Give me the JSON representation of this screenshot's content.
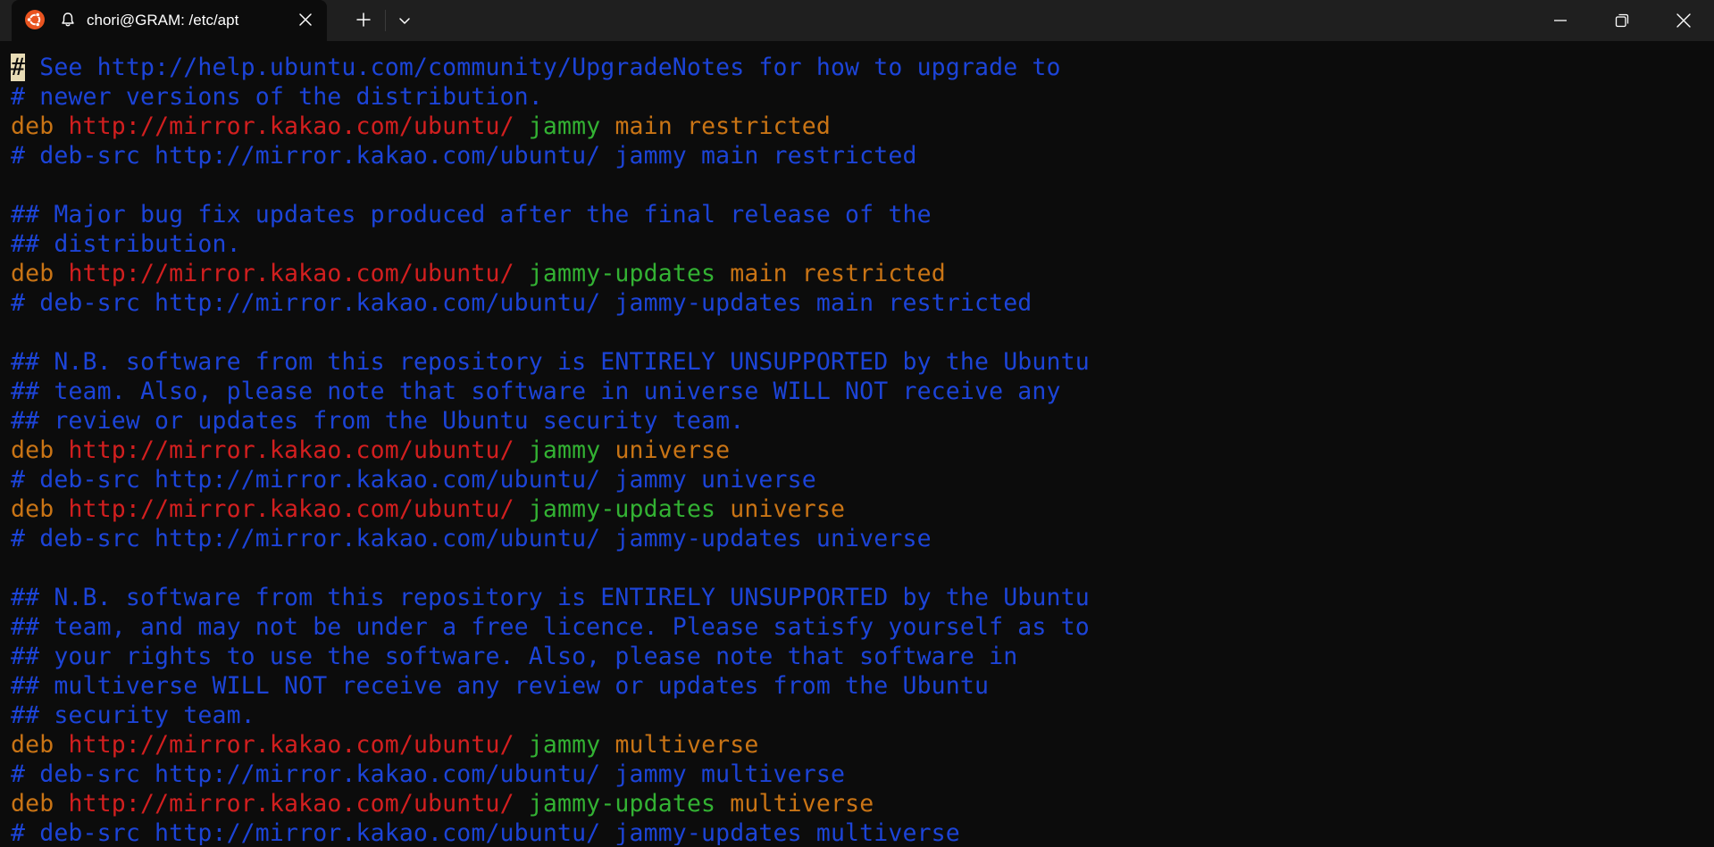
{
  "window": {
    "tab_title": "chori@GRAM: /etc/apt",
    "app_icon": "ubuntu-icon"
  },
  "colors": {
    "background": "#0c0c0c",
    "titlebar": "#1f1f1f",
    "comment": "#1c44d8",
    "keyword": "#c97415",
    "url": "#d21f1f",
    "suite": "#33b233",
    "component": "#c97415",
    "cursor": "#e8dcb6"
  },
  "terminal": {
    "cursor_char": "#",
    "lines": [
      {
        "type": "comment-cursor",
        "text": " See http://help.ubuntu.com/community/UpgradeNotes for how to upgrade to"
      },
      {
        "type": "comment",
        "text": "# newer versions of the distribution."
      },
      {
        "type": "deb",
        "kw": "deb",
        "url": "http://mirror.kakao.com/ubuntu/",
        "suite": "jammy",
        "comp": "main restricted"
      },
      {
        "type": "comment",
        "text": "# deb-src http://mirror.kakao.com/ubuntu/ jammy main restricted"
      },
      {
        "type": "blank",
        "text": ""
      },
      {
        "type": "comment",
        "text": "## Major bug fix updates produced after the final release of the"
      },
      {
        "type": "comment",
        "text": "## distribution."
      },
      {
        "type": "deb",
        "kw": "deb",
        "url": "http://mirror.kakao.com/ubuntu/",
        "suite": "jammy-updates",
        "comp": "main restricted"
      },
      {
        "type": "comment",
        "text": "# deb-src http://mirror.kakao.com/ubuntu/ jammy-updates main restricted"
      },
      {
        "type": "blank",
        "text": ""
      },
      {
        "type": "comment",
        "text": "## N.B. software from this repository is ENTIRELY UNSUPPORTED by the Ubuntu"
      },
      {
        "type": "comment",
        "text": "## team. Also, please note that software in universe WILL NOT receive any"
      },
      {
        "type": "comment",
        "text": "## review or updates from the Ubuntu security team."
      },
      {
        "type": "deb",
        "kw": "deb",
        "url": "http://mirror.kakao.com/ubuntu/",
        "suite": "jammy",
        "comp": "universe"
      },
      {
        "type": "comment",
        "text": "# deb-src http://mirror.kakao.com/ubuntu/ jammy universe"
      },
      {
        "type": "deb",
        "kw": "deb",
        "url": "http://mirror.kakao.com/ubuntu/",
        "suite": "jammy-updates",
        "comp": "universe"
      },
      {
        "type": "comment",
        "text": "# deb-src http://mirror.kakao.com/ubuntu/ jammy-updates universe"
      },
      {
        "type": "blank",
        "text": ""
      },
      {
        "type": "comment",
        "text": "## N.B. software from this repository is ENTIRELY UNSUPPORTED by the Ubuntu"
      },
      {
        "type": "comment",
        "text": "## team, and may not be under a free licence. Please satisfy yourself as to"
      },
      {
        "type": "comment",
        "text": "## your rights to use the software. Also, please note that software in"
      },
      {
        "type": "comment",
        "text": "## multiverse WILL NOT receive any review or updates from the Ubuntu"
      },
      {
        "type": "comment",
        "text": "## security team."
      },
      {
        "type": "deb",
        "kw": "deb",
        "url": "http://mirror.kakao.com/ubuntu/",
        "suite": "jammy",
        "comp": "multiverse"
      },
      {
        "type": "comment",
        "text": "# deb-src http://mirror.kakao.com/ubuntu/ jammy multiverse"
      },
      {
        "type": "deb",
        "kw": "deb",
        "url": "http://mirror.kakao.com/ubuntu/",
        "suite": "jammy-updates",
        "comp": "multiverse"
      },
      {
        "type": "comment",
        "text": "# deb-src http://mirror.kakao.com/ubuntu/ jammy-updates multiverse"
      }
    ]
  }
}
